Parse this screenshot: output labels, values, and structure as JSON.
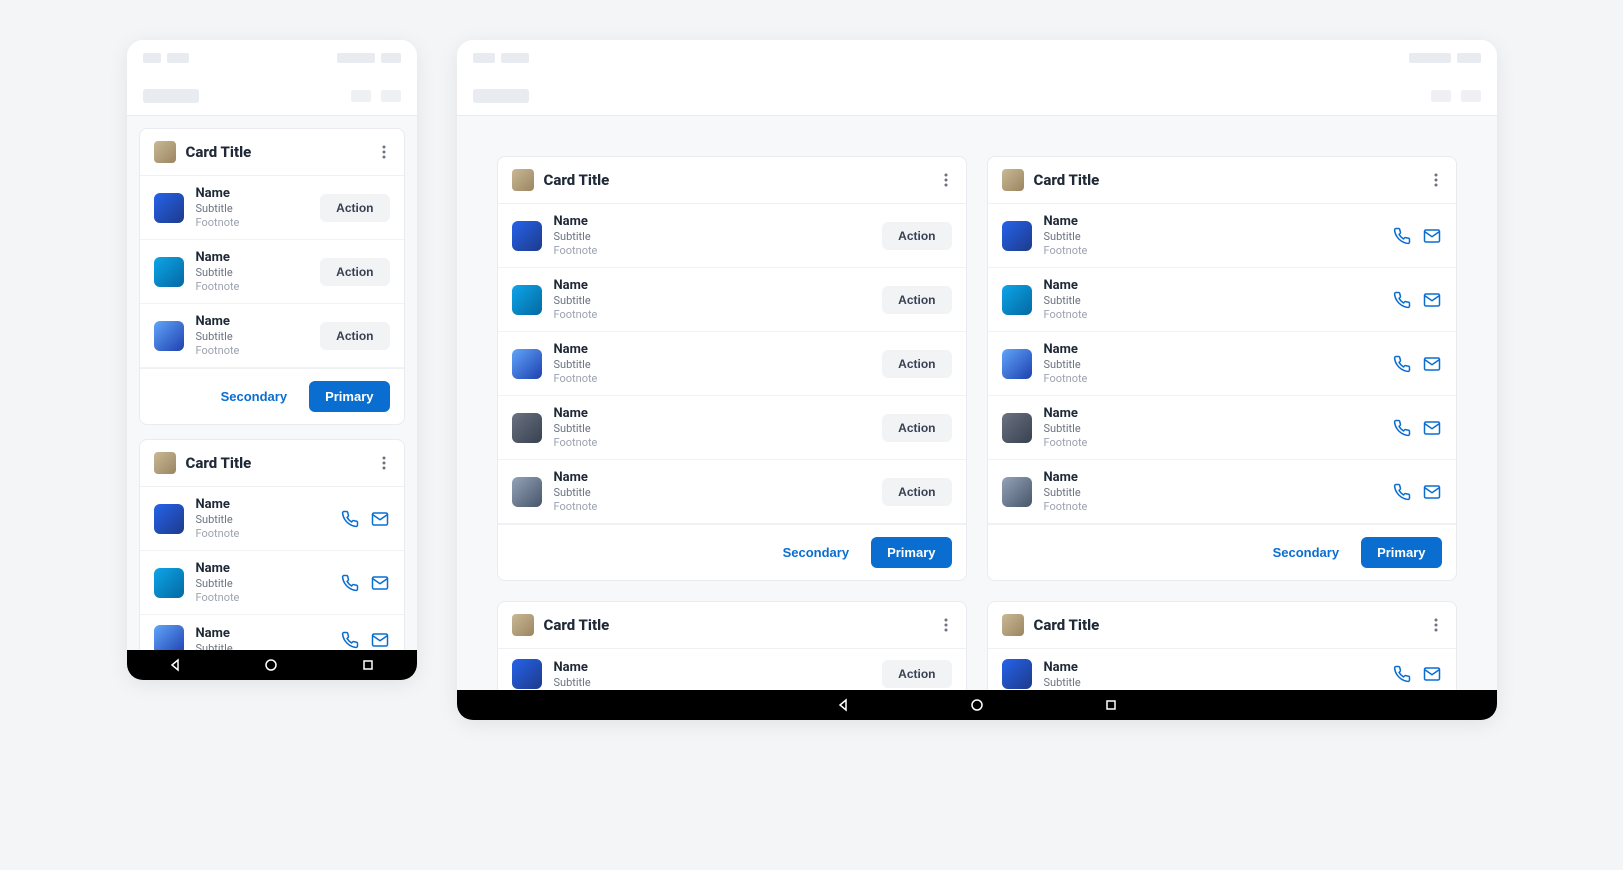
{
  "colors": {
    "accent": "#0a6ed1"
  },
  "labels": {
    "card_title": "Card Title",
    "name": "Name",
    "subtitle": "Subtitle",
    "footnote": "Footnote",
    "action": "Action",
    "secondary": "Secondary",
    "primary": "Primary"
  },
  "phone": {
    "cards": [
      {
        "type": "action",
        "items": 3,
        "footer": true
      },
      {
        "type": "icons",
        "items": 3,
        "footer": false,
        "truncated": true
      }
    ]
  },
  "tablet": {
    "grid1": [
      {
        "type": "action",
        "items": 5,
        "footer": true
      },
      {
        "type": "icons",
        "items": 5,
        "footer": true
      }
    ],
    "grid2": [
      {
        "type": "action",
        "items": 1,
        "footer": false,
        "truncated": true
      },
      {
        "type": "icons",
        "items": 1,
        "footer": false,
        "truncated": true
      }
    ]
  }
}
